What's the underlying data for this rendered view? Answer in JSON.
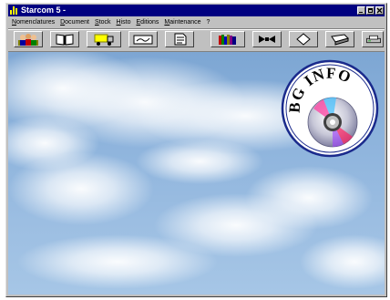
{
  "window": {
    "title": "Starcom 5 -"
  },
  "menu": {
    "items": [
      "Nomenclatures",
      "Document",
      "Stock",
      "Histo",
      "Editions",
      "Maintenance",
      "?"
    ]
  },
  "toolbar": {
    "buttons": [
      {
        "icon": "users-icon"
      },
      {
        "icon": "book-icon"
      },
      {
        "icon": "truck-icon"
      },
      {
        "icon": "keyboard-icon"
      },
      {
        "icon": "document-icon"
      },
      {
        "icon": "books-icon"
      },
      {
        "icon": "arrows-icon"
      },
      {
        "icon": "diskette-icon"
      },
      {
        "icon": "eraser-icon"
      },
      {
        "icon": "printer-icon"
      },
      {
        "icon": "tools-icon"
      }
    ]
  },
  "logo": {
    "text": "BG INFO",
    "ring_color": "#1a2a8c"
  },
  "colors": {
    "titlebar": "#000080",
    "sky": "#8db3dc"
  }
}
